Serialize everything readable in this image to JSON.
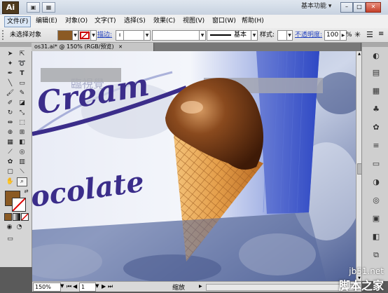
{
  "app": {
    "logo": "Ai"
  },
  "titlebar": {
    "workspace": "基本功能 ▾",
    "minimize": "–",
    "maximize": "□",
    "close": "✕"
  },
  "menu": [
    {
      "label": "文件(F)"
    },
    {
      "label": "编辑(E)"
    },
    {
      "label": "对象(O)"
    },
    {
      "label": "文字(T)"
    },
    {
      "label": "选择(S)"
    },
    {
      "label": "效果(C)"
    },
    {
      "label": "视图(V)"
    },
    {
      "label": "窗口(W)"
    },
    {
      "label": "帮助(H)"
    }
  ],
  "controlbar": {
    "selection_status": "未选择对象",
    "stroke_link": "描边:",
    "stroke_style_label": "基本",
    "style_label": "样式:",
    "opacity_link": "不透明度:",
    "opacity_value": "100",
    "opacity_unit": "%",
    "fill_color": "#8b5a24"
  },
  "document": {
    "tab_title": "os31.ai* @ 150% (RGB/预览)",
    "close": "✕"
  },
  "artwork": {
    "headline": "Cream",
    "subline": "ocolate",
    "brand_text": "臨視覺"
  },
  "statusbar": {
    "zoom": "150%",
    "page": "1",
    "tool_label": "缩放"
  },
  "watermark": {
    "line1": "jb51.net",
    "line2": "脚本之家"
  },
  "colors": {
    "accent": "#1f3fbf",
    "brand_blue": "#3b4fa8",
    "chocolate": "#5b2b12",
    "cone": "#e8a450"
  }
}
